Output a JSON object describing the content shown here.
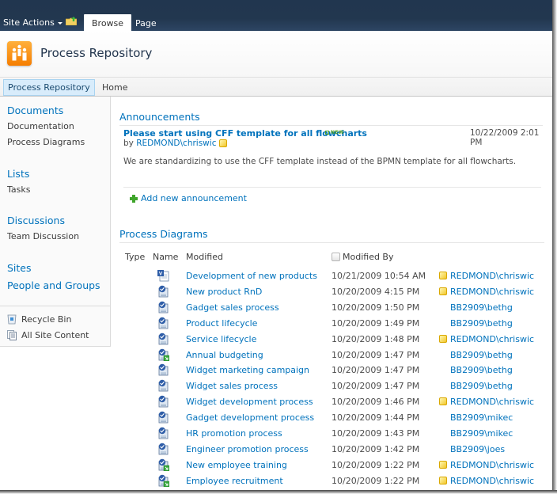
{
  "ribbon": {
    "site_actions_label": "Site Actions",
    "tabs": [
      {
        "label": "Browse",
        "selected": true
      },
      {
        "label": "Page",
        "selected": false
      }
    ]
  },
  "header": {
    "site_title": "Process Repository"
  },
  "topnav": {
    "items": [
      {
        "label": "Process Repository",
        "selected": true
      },
      {
        "label": "Home",
        "selected": false
      }
    ]
  },
  "quicklaunch": {
    "sections": [
      {
        "heading": "Documents",
        "items": [
          "Documentation",
          "Process Diagrams"
        ]
      },
      {
        "heading": "Lists",
        "items": [
          "Tasks"
        ]
      },
      {
        "heading": "Discussions",
        "items": [
          "Team Discussion"
        ]
      },
      {
        "heading": "Sites",
        "items": []
      },
      {
        "heading": "People and Groups",
        "items": []
      }
    ],
    "recycle_bin": "Recycle Bin",
    "all_site_content": "All Site Content"
  },
  "announcements": {
    "title": "Announcements",
    "items": [
      {
        "title": "Please start using CFF template for all flowcharts",
        "badge": "NEW",
        "by_prefix": "by",
        "author": "REDMOND\\chriswic",
        "date": "10/22/2009 2:01 PM",
        "body": "We are standardizing to use the CFF template instead of the BPMN template for all flowcharts."
      }
    ],
    "add_label": "Add new announcement"
  },
  "process_diagrams": {
    "title": "Process Diagrams",
    "columns": [
      "Type",
      "Name",
      "Modified",
      "Modified By"
    ],
    "rows": [
      {
        "type": "visio-drawing",
        "name": "Development of new products",
        "modified": "10/21/2009 10:54 AM",
        "modified_by": "REDMOND\\chriswic",
        "presence": true
      },
      {
        "type": "visio-process",
        "name": "New product RnD",
        "modified": "10/20/2009 4:15 PM",
        "modified_by": "REDMOND\\chriswic",
        "presence": true
      },
      {
        "type": "visio-process",
        "name": "Gadget sales process",
        "modified": "10/20/2009 1:50 PM",
        "modified_by": "BB2909\\bethg",
        "presence": false
      },
      {
        "type": "visio-process",
        "name": "Product lifecycle",
        "modified": "10/20/2009 1:49 PM",
        "modified_by": "BB2909\\bethg",
        "presence": false
      },
      {
        "type": "visio-process",
        "name": "Service lifecycle",
        "modified": "10/20/2009 1:48 PM",
        "modified_by": "REDMOND\\chriswic",
        "presence": true
      },
      {
        "type": "visio-process-shortcut",
        "name": "Annual budgeting",
        "modified": "10/20/2009 1:47 PM",
        "modified_by": "BB2909\\bethg",
        "presence": false
      },
      {
        "type": "visio-process",
        "name": "Widget marketing campaign",
        "modified": "10/20/2009 1:47 PM",
        "modified_by": "BB2909\\bethg",
        "presence": false
      },
      {
        "type": "visio-process",
        "name": "Widget sales process",
        "modified": "10/20/2009 1:47 PM",
        "modified_by": "BB2909\\bethg",
        "presence": false
      },
      {
        "type": "visio-process",
        "name": "Widget development process",
        "modified": "10/20/2009 1:46 PM",
        "modified_by": "REDMOND\\chriswic",
        "presence": true
      },
      {
        "type": "visio-process",
        "name": "Gadget development process",
        "modified": "10/20/2009 1:44 PM",
        "modified_by": "BB2909\\mikec",
        "presence": false
      },
      {
        "type": "visio-process",
        "name": "HR promotion process",
        "modified": "10/20/2009 1:43 PM",
        "modified_by": "BB2909\\mikec",
        "presence": false
      },
      {
        "type": "visio-process",
        "name": "Engineer promotion process",
        "modified": "10/20/2009 1:42 PM",
        "modified_by": "BB2909\\joes",
        "presence": false
      },
      {
        "type": "visio-process-shortcut",
        "name": "New employee training",
        "modified": "10/20/2009 1:22 PM",
        "modified_by": "REDMOND\\chriswic",
        "presence": true
      },
      {
        "type": "visio-process-shortcut",
        "name": "Employee recruitment",
        "modified": "10/20/2009 1:22 PM",
        "modified_by": "REDMOND\\chriswic",
        "presence": true
      }
    ]
  },
  "colors": {
    "ribbon_bg": "#22374f",
    "link": "#0072bc",
    "logo_orange": "#f57d00",
    "presence_yellow": "#f2c62a",
    "new_green": "#4a9b25"
  }
}
